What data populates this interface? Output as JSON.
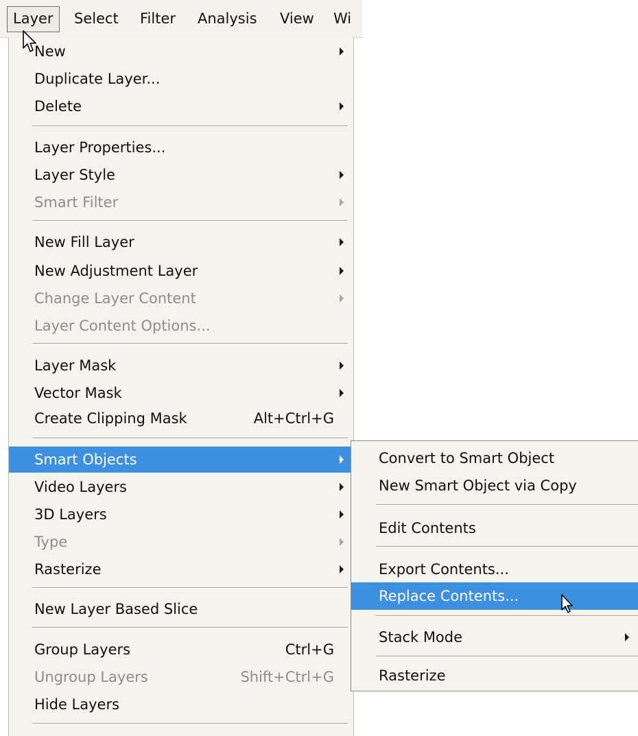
{
  "menubar": {
    "items": [
      "Layer",
      "Select",
      "Filter",
      "Analysis",
      "View",
      "Wi"
    ]
  },
  "layer_menu": {
    "items": [
      {
        "label": "New",
        "submenu": true
      },
      {
        "label": "Duplicate Layer..."
      },
      {
        "label": "Delete",
        "submenu": true
      },
      {
        "label": "Layer Properties..."
      },
      {
        "label": "Layer Style",
        "submenu": true
      },
      {
        "label": "Smart Filter",
        "submenu": true,
        "disabled": true
      },
      {
        "label": "New Fill Layer",
        "submenu": true
      },
      {
        "label": "New Adjustment Layer",
        "submenu": true
      },
      {
        "label": "Change Layer Content",
        "submenu": true,
        "disabled": true
      },
      {
        "label": "Layer Content Options...",
        "disabled": true
      },
      {
        "label": "Layer Mask",
        "submenu": true
      },
      {
        "label": "Vector Mask",
        "submenu": true
      },
      {
        "label": "Create Clipping Mask",
        "shortcut": "Alt+Ctrl+G"
      },
      {
        "label": "Smart Objects",
        "submenu": true,
        "selected": true
      },
      {
        "label": "Video Layers",
        "submenu": true
      },
      {
        "label": "3D Layers",
        "submenu": true
      },
      {
        "label": "Type",
        "submenu": true,
        "disabled": true
      },
      {
        "label": "Rasterize",
        "submenu": true
      },
      {
        "label": "New Layer Based Slice"
      },
      {
        "label": "Group Layers",
        "shortcut": "Ctrl+G"
      },
      {
        "label": "Ungroup Layers",
        "shortcut": "Shift+Ctrl+G",
        "disabled": true
      },
      {
        "label": "Hide Layers"
      }
    ]
  },
  "smart_objects_menu": {
    "items": [
      {
        "label": "Convert to Smart Object"
      },
      {
        "label": "New Smart Object via Copy"
      },
      {
        "label": "Edit Contents"
      },
      {
        "label": "Export Contents..."
      },
      {
        "label": "Replace Contents...",
        "selected": true
      },
      {
        "label": "Stack Mode",
        "submenu": true
      },
      {
        "label": "Rasterize"
      }
    ]
  },
  "colors": {
    "highlight": "#3d8fe0",
    "menu_bg": "#f4f3ed",
    "disabled_text": "#8d8d8d"
  },
  "icons": [
    "arrow-pointer-icon",
    "submenu-arrow-icon"
  ]
}
